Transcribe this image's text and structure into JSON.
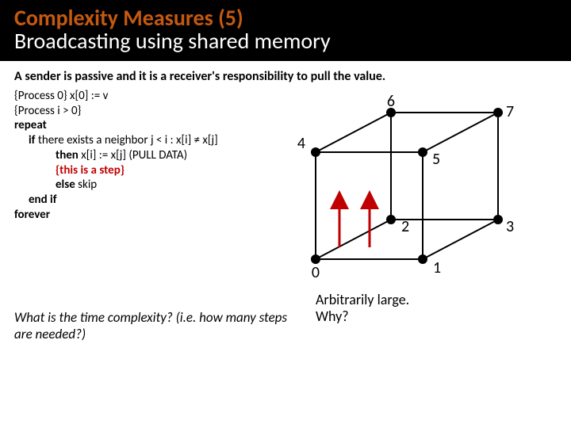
{
  "title": {
    "main": "Complexity Measures (5)",
    "sub": "Broadcasting using shared memory"
  },
  "intro": "A sender is passive and it is a receiver's responsibility to pull the value.",
  "code": {
    "l1": "{Process 0} x[0] := v",
    "l2": "{Process i > 0}",
    "l3": "repeat",
    "l4a": "if",
    "l4b": "  there exists a neighbor j < i : x[i] ≠ x[j]",
    "l5a": "then",
    "l5b": " x[i] := x[j]  (PULL DATA)",
    "l6": "{this is a step}",
    "l7a": "else",
    "l7b": " skip",
    "l8": "end if",
    "l9": "forever"
  },
  "cube": {
    "labels": {
      "n0": "0",
      "n1": "1",
      "n2": "2",
      "n3": "3",
      "n4": "4",
      "n5": "5",
      "n6": "6",
      "n7": "7"
    }
  },
  "question": "What is the time complexity? (i.e. how many steps are needed?)",
  "answer": {
    "line1": "Arbitrarily large.",
    "line2": "Why?"
  },
  "colors": {
    "accent": "#c00000",
    "titleAccent": "#c55910"
  }
}
